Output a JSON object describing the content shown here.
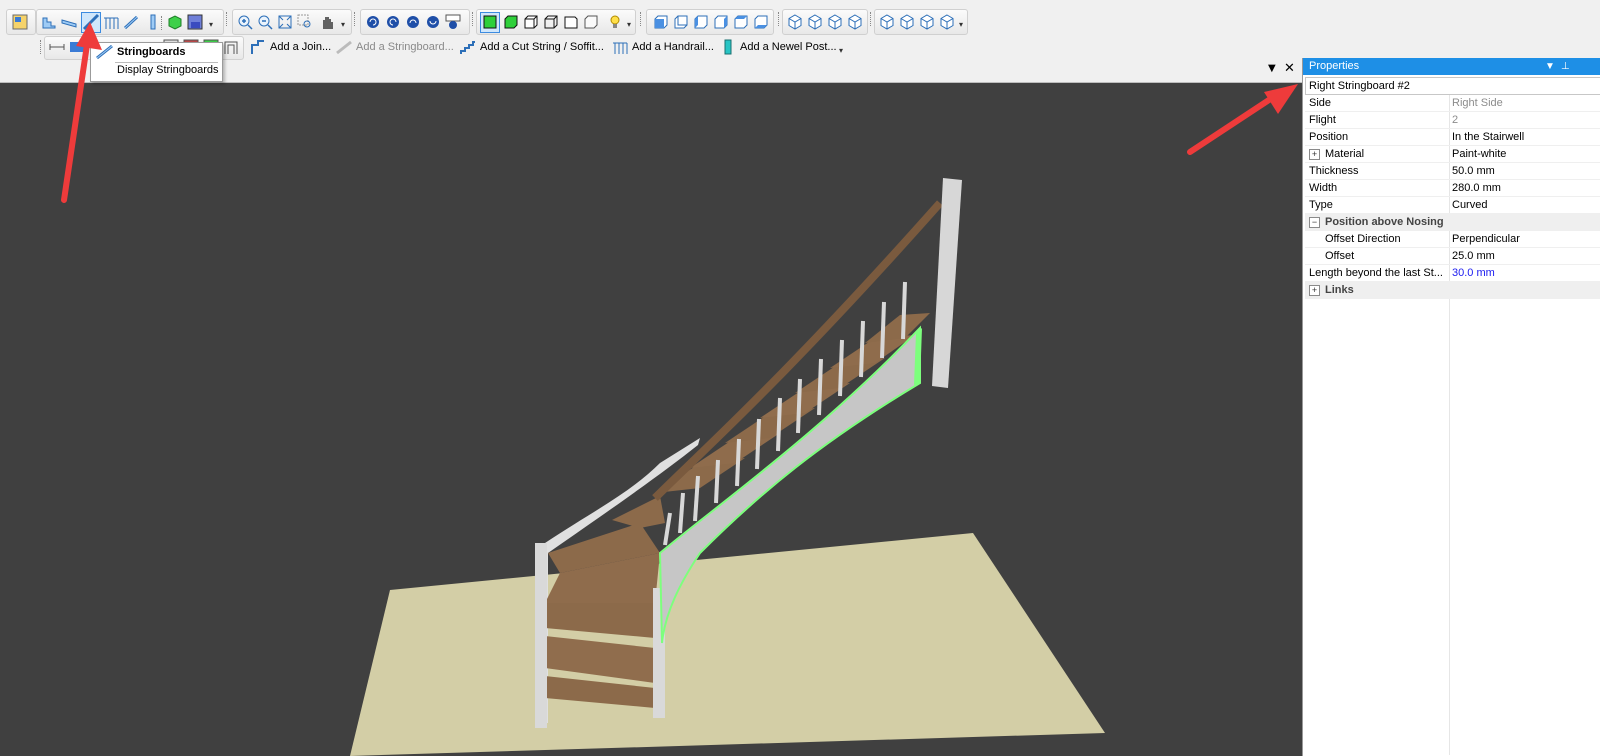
{
  "toolbar2": {
    "add_join": "Add a Join...",
    "add_stringboard": "Add a Stringboard...",
    "add_cut_string": "Add a Cut String / Soffit...",
    "add_handrail": "Add a Handrail...",
    "add_newel": "Add a Newel Post..."
  },
  "dropdown": {
    "header": "Stringboards",
    "item": "Display Stringboards"
  },
  "properties": {
    "title": "Properties",
    "selected_object": "Right Stringboard #2",
    "rows": [
      {
        "key": "Side",
        "value": "Right Side"
      },
      {
        "key": "Flight",
        "value": "2"
      },
      {
        "key": "Position",
        "value": "In the Stairwell"
      },
      {
        "key": "Material",
        "value": "Paint-white"
      },
      {
        "key": "Thickness",
        "value": "50.0 mm"
      },
      {
        "key": "Width",
        "value": "280.0 mm"
      },
      {
        "key": "Type",
        "value": "Curved"
      },
      {
        "key": "Position above Nosing",
        "value": ""
      },
      {
        "key": "Offset Direction",
        "value": "Perpendicular"
      },
      {
        "key": "Offset",
        "value": "25.0 mm"
      },
      {
        "key": "Length beyond the last St...",
        "value": "30.0 mm"
      },
      {
        "key": "Links",
        "value": ""
      }
    ]
  },
  "colors": {
    "viewport_bg": "#404040",
    "floor": "#d3cea6",
    "tread": "#8c6a4a",
    "highlight": "#7dff7d",
    "title_bar": "#1e8fe6",
    "arrow": "#ee3b3b"
  }
}
